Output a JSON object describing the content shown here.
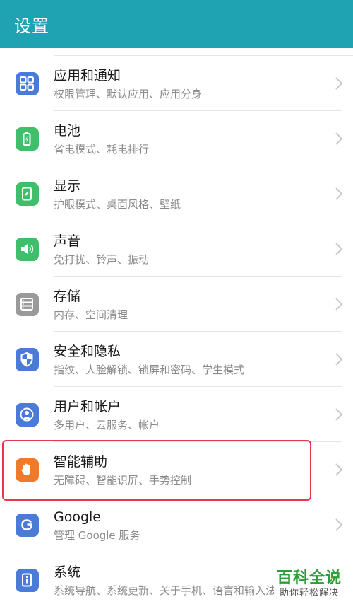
{
  "header": {
    "title": "设置"
  },
  "items": [
    {
      "title": "应用和通知",
      "subtitle": "权限管理、默认应用、应用分身",
      "icon": "apps-grid-icon",
      "color": "#4a7bd9"
    },
    {
      "title": "电池",
      "subtitle": "省电模式、耗电排行",
      "icon": "battery-icon",
      "color": "#3fbf6a"
    },
    {
      "title": "显示",
      "subtitle": "护眼模式、桌面风格、壁纸",
      "icon": "display-icon",
      "color": "#3fbf6a"
    },
    {
      "title": "声音",
      "subtitle": "免打扰、铃声、振动",
      "icon": "speaker-icon",
      "color": "#3fbf6a"
    },
    {
      "title": "存储",
      "subtitle": "内存、空间清理",
      "icon": "storage-icon",
      "color": "#9a9a9a"
    },
    {
      "title": "安全和隐私",
      "subtitle": "指纹、人脸解锁、锁屏和密码、学生模式",
      "icon": "shield-icon",
      "color": "#4a7bd9"
    },
    {
      "title": "用户和帐户",
      "subtitle": "多用户、云服务、帐户",
      "icon": "user-icon",
      "color": "#4a7bd9"
    },
    {
      "title": "智能辅助",
      "subtitle": "无障碍、智能识屏、手势控制",
      "icon": "hand-icon",
      "color": "#f07a2a"
    },
    {
      "title": "Google",
      "subtitle": "管理 Google 服务",
      "icon": "google-icon",
      "color": "#4a7bd9"
    },
    {
      "title": "系统",
      "subtitle": "系统导航、系统更新、关于手机、语言和输入法",
      "icon": "info-icon",
      "color": "#4a7bd9"
    }
  ],
  "watermark": {
    "title": "百科全说",
    "subtitle": "助你轻松解决"
  }
}
